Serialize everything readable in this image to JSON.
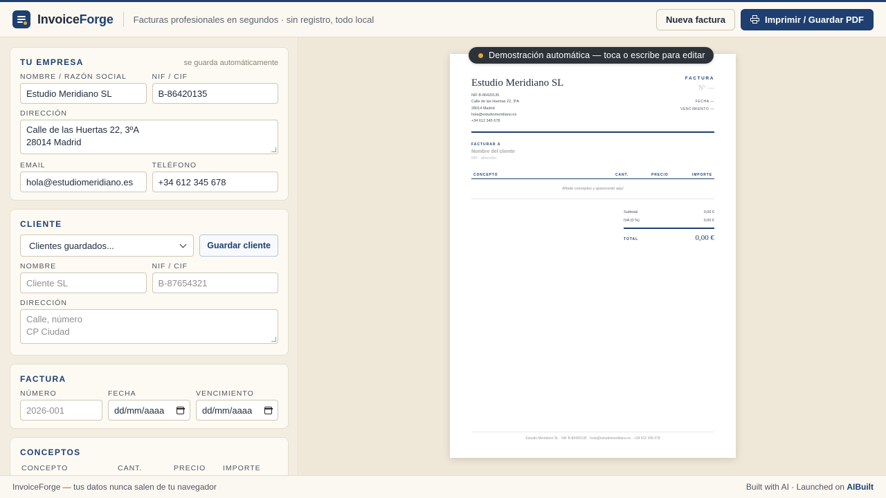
{
  "app": {
    "brand_main": "Invoice",
    "brand_accent": "Forge",
    "tagline": "Facturas profesionales en segundos · sin registro, todo local",
    "new_invoice_label": "Nueva factura",
    "print_label": "Imprimir / Guardar PDF",
    "accent_color": "#1e3f70",
    "highlight_color": "#e3a83a"
  },
  "company": {
    "title": "TU EMPRESA",
    "autosave": "se guarda automáticamente",
    "name_label": "NOMBRE / RAZÓN SOCIAL",
    "name_value": "Estudio Meridiano SL",
    "nif_label": "NIF / CIF",
    "nif_value": "B-86420135",
    "address_label": "DIRECCIÓN",
    "address_line1": "Calle de las Huertas 22, 3ºA",
    "address_line2": "28014 Madrid",
    "email_label": "EMAIL",
    "email_value": "hola@estudiomeridiano.es",
    "phone_label": "TELÉFONO",
    "phone_value": "+34 612 345 678"
  },
  "client": {
    "title": "CLIENTE",
    "select_value": "Clientes guardados...",
    "save_label": "Guardar cliente",
    "name_label": "NOMBRE",
    "name_placeholder": "Cliente SL",
    "nif_label": "NIF / CIF",
    "nif_placeholder": "B-87654321",
    "address_label": "DIRECCIÓN",
    "address_placeholder1": "Calle, número",
    "address_placeholder2": "CP Ciudad"
  },
  "invoice": {
    "title": "FACTURA",
    "number_label": "NÚMERO",
    "number_placeholder": "2026-001",
    "date_label": "FECHA",
    "date_value": "dd/mm/aaaa",
    "due_label": "VENCIMIENTO",
    "due_value": "dd/mm/aaaa"
  },
  "concepts": {
    "title": "CONCEPTOS",
    "col_concept": "CONCEPTO",
    "col_qty": "CANT.",
    "col_price": "PRECIO",
    "col_amount": "IMPORTE"
  },
  "preview": {
    "demo_banner": "Demostración automática — toca o escribe para editar",
    "company_name": "Estudio Meridiano SL",
    "company_nif": "NIF B-86420135",
    "company_addr1": "Calle de las Huertas 22, 3ºA",
    "company_addr2": "28014 Madrid",
    "company_email": "hola@estudiomeridiano.es",
    "company_phone": "+34 612 345 678",
    "doc_title": "FACTURA",
    "doc_number": "Nº —",
    "date_row": "FECHA —",
    "due_row": "VENCIMIENTO —",
    "bill_to": "FACTURAR A",
    "client_placeholder": "Nombre del cliente",
    "client_sub": "NIF · dirección",
    "th_concept": "CONCEPTO",
    "th_qty": "CANT.",
    "th_price": "PRECIO",
    "th_amount": "IMPORTE",
    "empty_text": "Añade conceptos y aparecerán aquí",
    "subtotal_label": "Subtotal",
    "subtotal_value": "0,00 €",
    "iva_label": "IVA (0 %)",
    "iva_value": "0,00 €",
    "total_label": "TOTAL",
    "total_value": "0,00 €",
    "footer_text": "Estudio Meridiano SL · NIF B-86420135 · hola@estudiomeridiano.es · +34 612 345 678"
  },
  "footer": {
    "left": "InvoiceForge — tus datos nunca salen de tu navegador",
    "right_prefix": "Built with AI · Launched on",
    "right_link": "AIBuilt"
  }
}
